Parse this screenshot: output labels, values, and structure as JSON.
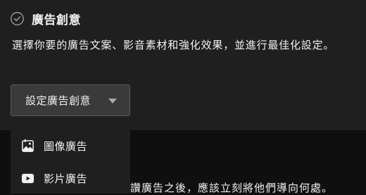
{
  "section": {
    "title": "廣告創意",
    "description": "選擇你要的廣告文案、影音素材和強化效果，並進行最佳化設定。"
  },
  "dropdown": {
    "label": "設定廣告創意",
    "options": [
      {
        "label": "圖像廣告",
        "icon": "image-icon"
      },
      {
        "label": "影片廣告",
        "icon": "video-icon"
      }
    ]
  },
  "background_text": "讚廣告之後，應該立刻將他們導向何處。",
  "colors": {
    "panel": "#1f1f1f",
    "page": "#0f0f0f",
    "button": "#3a3a3a",
    "text": "#f1f1f1"
  }
}
